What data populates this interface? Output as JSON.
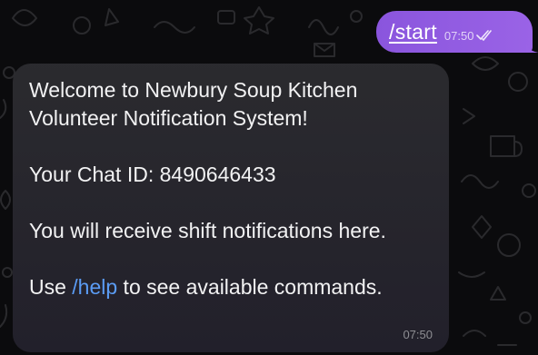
{
  "chat": {
    "outgoing": {
      "text": "/start",
      "time": "07:50",
      "status_icon": "double-check-icon",
      "bubble_color": "#9160e3"
    },
    "incoming": {
      "lines": [
        "Welcome to Newbury Soup Kitchen",
        "Volunteer Notification System!",
        "Your Chat ID: 8490646433",
        "You will receive shift notifications here."
      ],
      "help_prefix": "Use ",
      "help_command": "/help",
      "help_suffix": " to see available commands.",
      "time": "07:50",
      "link_color": "#5b9cf5"
    },
    "background_color": "#0b0b0d"
  }
}
